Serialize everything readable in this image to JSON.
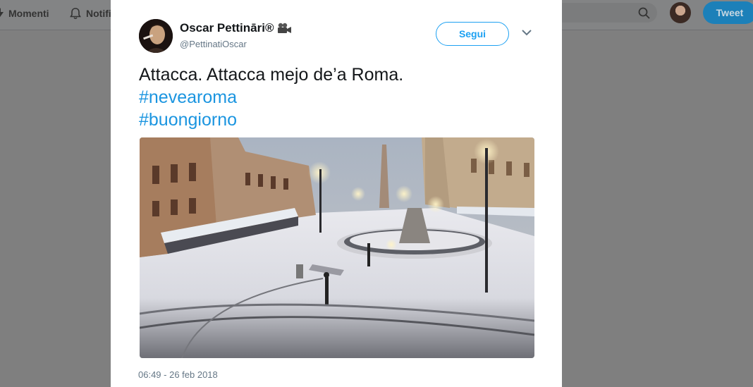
{
  "nav": {
    "moments_label": "Momenti",
    "notifications_label": "Notifi",
    "tweet_button_label": "Tweet"
  },
  "tweet": {
    "author_name": "Oscar Pettināri®",
    "author_handle": "@PettinatiOscar",
    "follow_label": "Segui",
    "text": "Attacca. Attacca mejo de’a Roma.",
    "hashtags": [
      "#nevearoma",
      "#buongiorno"
    ],
    "timestamp": "06:49 - 26 feb 2018"
  },
  "icons": {
    "moments": "lightning-icon",
    "notifications": "bell-icon",
    "search": "search-icon",
    "name_emoji": "movie-camera-icon",
    "caret": "chevron-down-icon"
  },
  "colors": {
    "accent": "#1da1f2",
    "hashtag": "#1b95e0",
    "overlay": "#7f7f7f"
  }
}
